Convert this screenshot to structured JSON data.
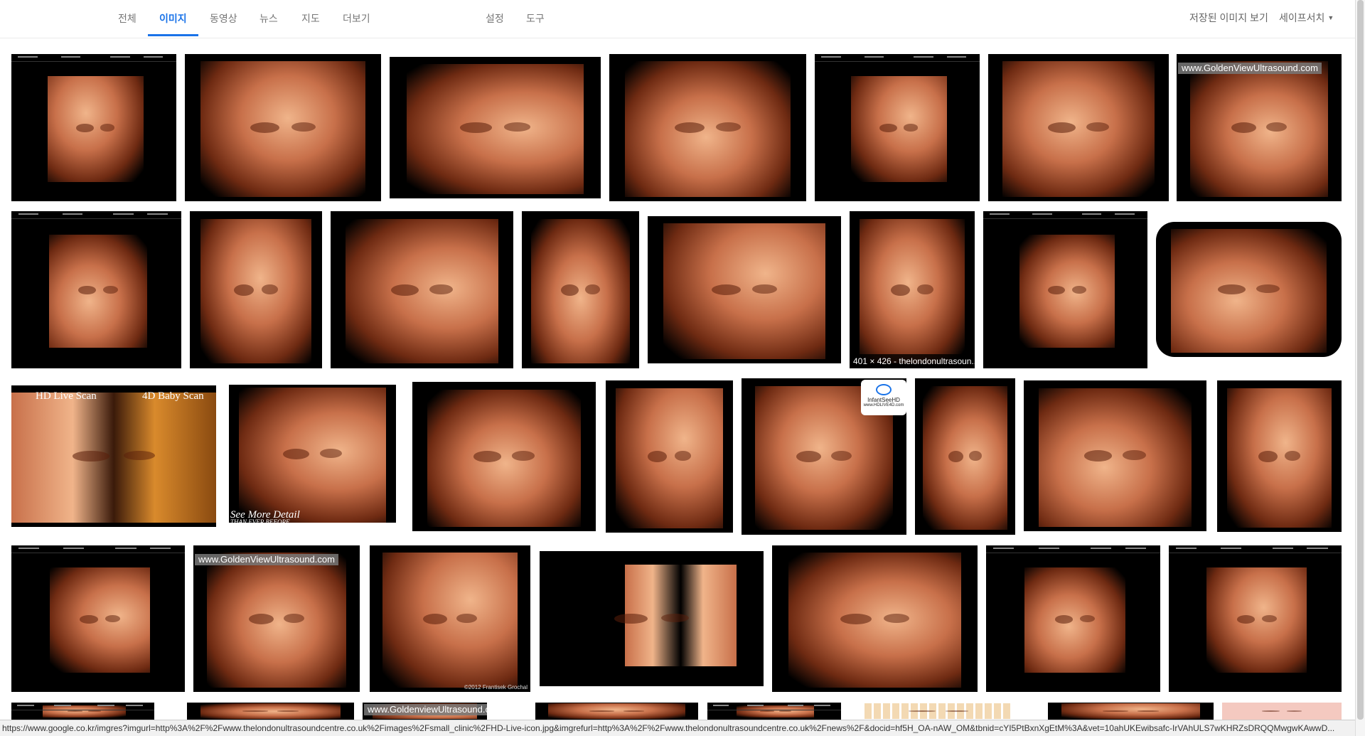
{
  "tabs": [
    {
      "label": "전체",
      "active": false
    },
    {
      "label": "이미지",
      "active": true
    },
    {
      "label": "동영상",
      "active": false
    },
    {
      "label": "뉴스",
      "active": false
    },
    {
      "label": "지도",
      "active": false
    },
    {
      "label": "더보기",
      "active": false
    }
  ],
  "tools": {
    "settings": "설정",
    "tools": "도구"
  },
  "header_right": {
    "saved_images": "저장된 이미지 보기",
    "safesearch": "세이프서치"
  },
  "results": {
    "watermark": "www.GoldenViewUltrasound.com",
    "watermark_alt": "www.GoldenviewUltrasound.com",
    "hover_caption": "401 × 426 - thelondonultrasoun...",
    "hd_live_scan": "HD Live Scan",
    "baby_scan_4d": "4D Baby Scan",
    "see_more": "See More Detail",
    "than_ever": "THAN EVER BEFORE",
    "infantsee": "InfantSeeHD",
    "infantsee_url": "www.HDLIVE4D.com",
    "copyright": "©2012 Frantisek Grochal"
  },
  "status_url": "https://www.google.co.kr/imgres?imgurl=http%3A%2F%2Fwww.thelondonultrasoundcentre.co.uk%2Fimages%2Fsmall_clinic%2FHD-Live-icon.jpg&imgrefurl=http%3A%2F%2Fwww.thelondonultrasoundcentre.co.uk%2Fnews%2F&docid=hf5H_OA-nAW_OM&tbnid=cYI5PtBxnXgEtM%3A&vet=10ahUKEwibsafc-IrVAhULS7wKHRZsDRQQMwgwKAwwD...",
  "colors": {
    "accent": "#1a73e8",
    "flesh_light": "#f0b48a",
    "flesh_mid": "#c8704a",
    "flesh_dark": "#6e2a12"
  }
}
